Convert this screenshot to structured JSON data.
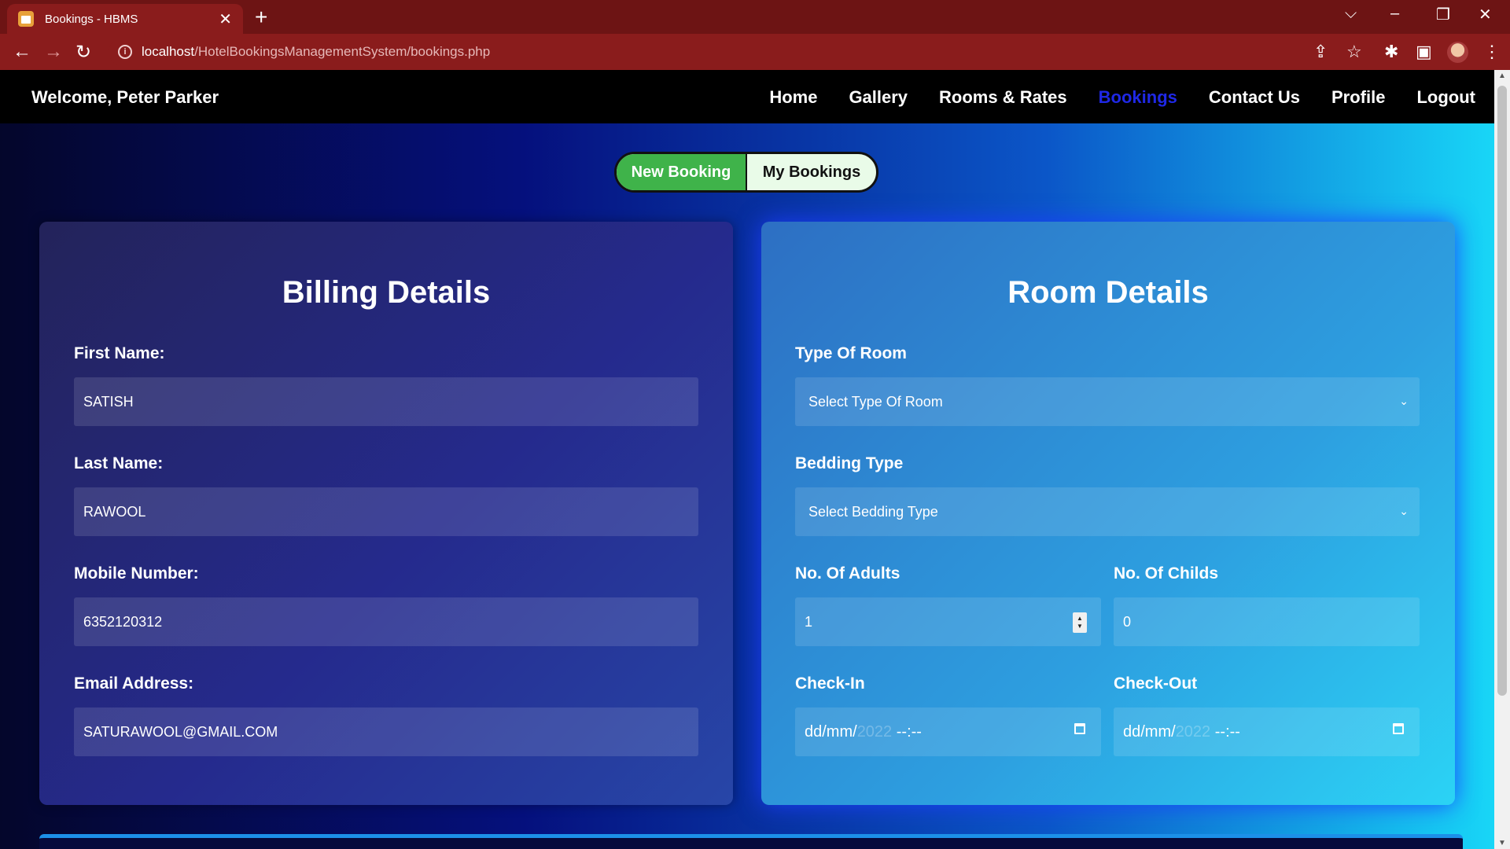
{
  "browser": {
    "tab_title": "Bookings - HBMS",
    "url_host": "localhost",
    "url_path": "/HotelBookingsManagementSystem/bookings.php"
  },
  "nav": {
    "welcome": "Welcome, Peter Parker",
    "items": [
      {
        "label": "Home",
        "active": false
      },
      {
        "label": "Gallery",
        "active": false
      },
      {
        "label": "Rooms & Rates",
        "active": false
      },
      {
        "label": "Bookings",
        "active": true
      },
      {
        "label": "Contact Us",
        "active": false
      },
      {
        "label": "Profile",
        "active": false
      },
      {
        "label": "Logout",
        "active": false
      }
    ]
  },
  "toggle": {
    "new_booking": "New Booking",
    "my_bookings": "My Bookings"
  },
  "billing": {
    "title": "Billing Details",
    "first_name_label": "First Name:",
    "first_name": "SATISH",
    "last_name_label": "Last Name:",
    "last_name": "RAWOOL",
    "mobile_label": "Mobile Number:",
    "mobile": "6352120312",
    "email_label": "Email Address:",
    "email": "SATURAWOOL@GMAIL.COM"
  },
  "room": {
    "title": "Room Details",
    "type_label": "Type Of Room",
    "type_value": "Select Type Of Room",
    "bedding_label": "Bedding Type",
    "bedding_value": "Select Bedding Type",
    "adults_label": "No. Of Adults",
    "adults": "1",
    "childs_label": "No. Of Childs",
    "childs": "0",
    "checkin_label": "Check-In",
    "checkin_prefix": "dd/mm/",
    "checkin_year": "2022",
    "checkin_time": " --:--",
    "checkout_label": "Check-Out",
    "checkout_prefix": "dd/mm/",
    "checkout_year": "2022",
    "checkout_time": " --:--"
  }
}
